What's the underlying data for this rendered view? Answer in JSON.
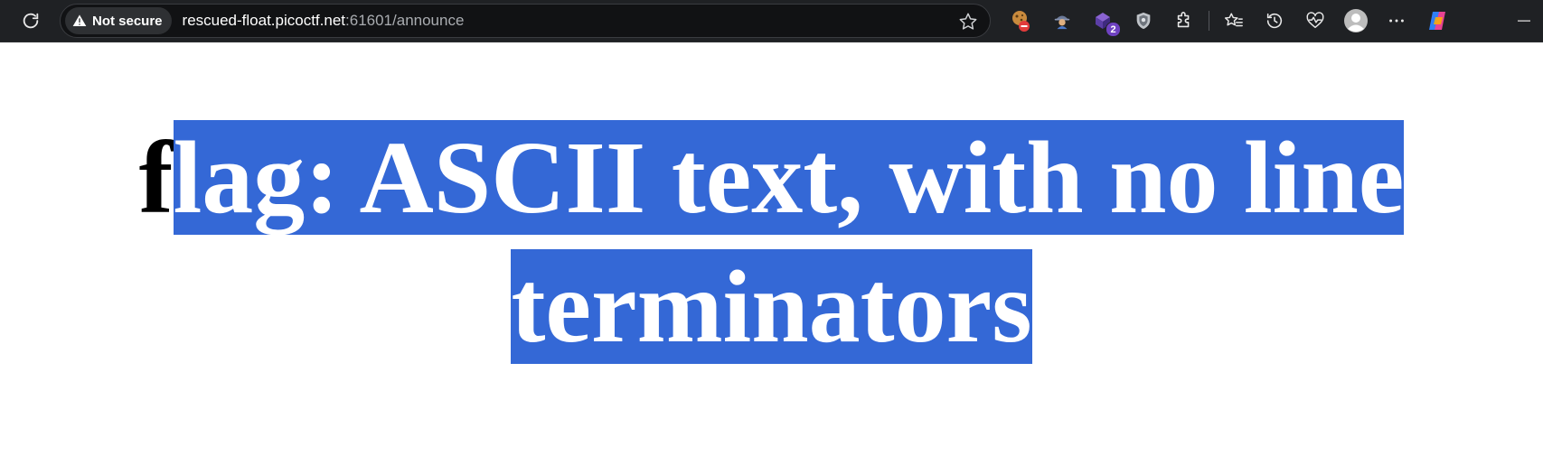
{
  "browser": {
    "security_label": "Not secure",
    "url_host": "rescued-float.picoctf.net",
    "url_rest": ":61601/announce",
    "extension_badge_count": "2",
    "icons": {
      "reload": "reload-icon",
      "warning": "warning-icon",
      "favorite": "star-outline-icon",
      "extensions": [
        "cookie-extension-icon",
        "spy-extension-icon",
        "purple-extension-icon",
        "shield-extension-icon",
        "puzzle-icon"
      ],
      "favorites": "favorites-icon",
      "history": "history-icon",
      "health": "heartbeat-icon",
      "profile": "profile-avatar-icon",
      "more": "more-icon",
      "copilot": "copilot-icon",
      "minimize": "minimize-icon"
    }
  },
  "page": {
    "heading_first_char": "f",
    "heading_selected": "lag: ASCII text, with no line terminators"
  },
  "colors": {
    "toolbar_bg": "#1f2124",
    "selection_bg": "#3468d6",
    "selection_text": "#ffffff",
    "page_bg": "#ffffff"
  }
}
